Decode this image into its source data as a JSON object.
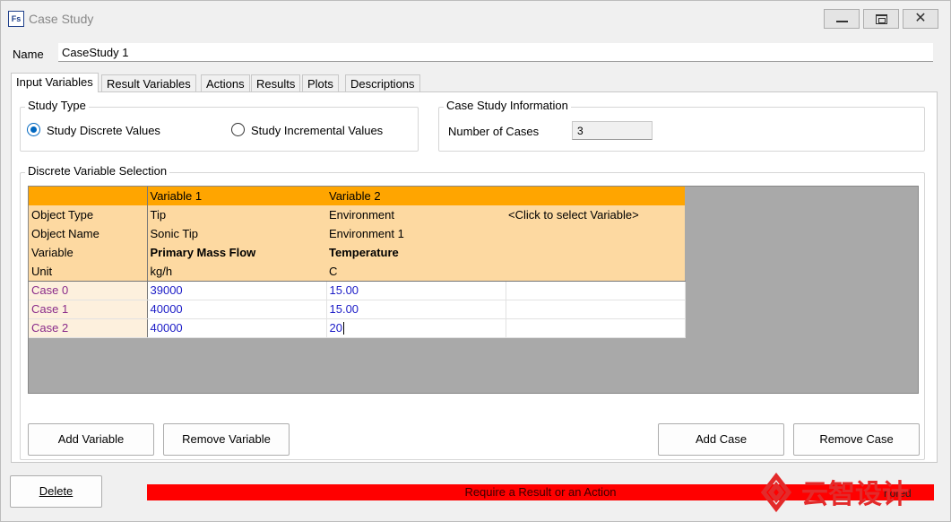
{
  "window": {
    "app_icon": "Fs",
    "title": "Case Study",
    "controls": {
      "minimize": "minimize",
      "maximize": "maximize",
      "close": "✕"
    }
  },
  "name": {
    "label": "Name",
    "value": "CaseStudy 1"
  },
  "tabs": [
    {
      "label": "Input Variables",
      "active": true
    },
    {
      "label": "Result Variables"
    },
    {
      "label": "Actions"
    },
    {
      "label": "Results"
    },
    {
      "label": "Plots"
    },
    {
      "label": "Descriptions"
    }
  ],
  "study_type": {
    "legend": "Study Type",
    "options": [
      {
        "label": "Study Discrete Values",
        "checked": true
      },
      {
        "label": "Study Incremental Values",
        "checked": false
      }
    ]
  },
  "case_info": {
    "legend": "Case Study Information",
    "number_label": "Number of Cases",
    "number_value": "3"
  },
  "selection": {
    "legend": "Discrete Variable Selection",
    "headers": [
      "",
      "Variable 1",
      "Variable 2",
      ""
    ],
    "meta_rows": [
      [
        "Object Type",
        "Tip",
        "Environment",
        "<Click to select Variable>"
      ],
      [
        "Object Name",
        "Sonic Tip",
        "Environment 1",
        ""
      ],
      [
        "Variable",
        "Primary Mass Flow",
        "Temperature",
        ""
      ],
      [
        "Unit",
        "kg/h",
        "C",
        ""
      ]
    ],
    "cases": [
      [
        "Case 0",
        "39000",
        "15.00",
        ""
      ],
      [
        "Case 1",
        "40000",
        "15.00",
        ""
      ],
      [
        "Case 2",
        "40000",
        "20",
        ""
      ]
    ]
  },
  "buttons": {
    "add_variable": "Add Variable",
    "remove_variable": "Remove Variable",
    "add_case": "Add Case",
    "remove_case": "Remove Case",
    "delete": "Delete"
  },
  "status": {
    "message": "Require a Result or an Action",
    "trailing": "nored"
  },
  "watermark": {
    "text": "云智设计",
    "color": "#e32a2a"
  },
  "colors": {
    "grid_header": "#ffa500",
    "grid_meta": "#fdd9a1",
    "case_label": "#8a2b8a",
    "case_value": "#1c1cc7",
    "status_bar": "#ff0000",
    "radio_accent": "#0067c0"
  }
}
